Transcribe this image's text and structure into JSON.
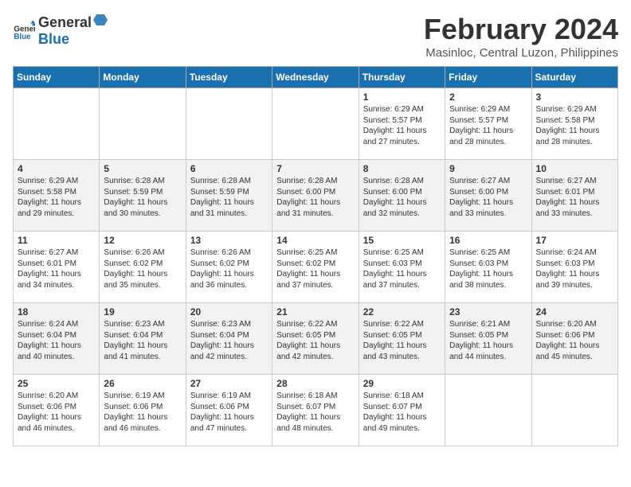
{
  "header": {
    "logo_general": "General",
    "logo_blue": "Blue",
    "title": "February 2024",
    "subtitle": "Masinloc, Central Luzon, Philippines"
  },
  "days_of_week": [
    "Sunday",
    "Monday",
    "Tuesday",
    "Wednesday",
    "Thursday",
    "Friday",
    "Saturday"
  ],
  "weeks": [
    [
      {
        "day": "",
        "content": ""
      },
      {
        "day": "",
        "content": ""
      },
      {
        "day": "",
        "content": ""
      },
      {
        "day": "",
        "content": ""
      },
      {
        "day": "1",
        "content": "Sunrise: 6:29 AM\nSunset: 5:57 PM\nDaylight: 11 hours and 27 minutes."
      },
      {
        "day": "2",
        "content": "Sunrise: 6:29 AM\nSunset: 5:57 PM\nDaylight: 11 hours and 28 minutes."
      },
      {
        "day": "3",
        "content": "Sunrise: 6:29 AM\nSunset: 5:58 PM\nDaylight: 11 hours and 28 minutes."
      }
    ],
    [
      {
        "day": "4",
        "content": "Sunrise: 6:29 AM\nSunset: 5:58 PM\nDaylight: 11 hours and 29 minutes."
      },
      {
        "day": "5",
        "content": "Sunrise: 6:28 AM\nSunset: 5:59 PM\nDaylight: 11 hours and 30 minutes."
      },
      {
        "day": "6",
        "content": "Sunrise: 6:28 AM\nSunset: 5:59 PM\nDaylight: 11 hours and 31 minutes."
      },
      {
        "day": "7",
        "content": "Sunrise: 6:28 AM\nSunset: 6:00 PM\nDaylight: 11 hours and 31 minutes."
      },
      {
        "day": "8",
        "content": "Sunrise: 6:28 AM\nSunset: 6:00 PM\nDaylight: 11 hours and 32 minutes."
      },
      {
        "day": "9",
        "content": "Sunrise: 6:27 AM\nSunset: 6:00 PM\nDaylight: 11 hours and 33 minutes."
      },
      {
        "day": "10",
        "content": "Sunrise: 6:27 AM\nSunset: 6:01 PM\nDaylight: 11 hours and 33 minutes."
      }
    ],
    [
      {
        "day": "11",
        "content": "Sunrise: 6:27 AM\nSunset: 6:01 PM\nDaylight: 11 hours and 34 minutes."
      },
      {
        "day": "12",
        "content": "Sunrise: 6:26 AM\nSunset: 6:02 PM\nDaylight: 11 hours and 35 minutes."
      },
      {
        "day": "13",
        "content": "Sunrise: 6:26 AM\nSunset: 6:02 PM\nDaylight: 11 hours and 36 minutes."
      },
      {
        "day": "14",
        "content": "Sunrise: 6:25 AM\nSunset: 6:02 PM\nDaylight: 11 hours and 37 minutes."
      },
      {
        "day": "15",
        "content": "Sunrise: 6:25 AM\nSunset: 6:03 PM\nDaylight: 11 hours and 37 minutes."
      },
      {
        "day": "16",
        "content": "Sunrise: 6:25 AM\nSunset: 6:03 PM\nDaylight: 11 hours and 38 minutes."
      },
      {
        "day": "17",
        "content": "Sunrise: 6:24 AM\nSunset: 6:03 PM\nDaylight: 11 hours and 39 minutes."
      }
    ],
    [
      {
        "day": "18",
        "content": "Sunrise: 6:24 AM\nSunset: 6:04 PM\nDaylight: 11 hours and 40 minutes."
      },
      {
        "day": "19",
        "content": "Sunrise: 6:23 AM\nSunset: 6:04 PM\nDaylight: 11 hours and 41 minutes."
      },
      {
        "day": "20",
        "content": "Sunrise: 6:23 AM\nSunset: 6:04 PM\nDaylight: 11 hours and 42 minutes."
      },
      {
        "day": "21",
        "content": "Sunrise: 6:22 AM\nSunset: 6:05 PM\nDaylight: 11 hours and 42 minutes."
      },
      {
        "day": "22",
        "content": "Sunrise: 6:22 AM\nSunset: 6:05 PM\nDaylight: 11 hours and 43 minutes."
      },
      {
        "day": "23",
        "content": "Sunrise: 6:21 AM\nSunset: 6:05 PM\nDaylight: 11 hours and 44 minutes."
      },
      {
        "day": "24",
        "content": "Sunrise: 6:20 AM\nSunset: 6:06 PM\nDaylight: 11 hours and 45 minutes."
      }
    ],
    [
      {
        "day": "25",
        "content": "Sunrise: 6:20 AM\nSunset: 6:06 PM\nDaylight: 11 hours and 46 minutes."
      },
      {
        "day": "26",
        "content": "Sunrise: 6:19 AM\nSunset: 6:06 PM\nDaylight: 11 hours and 46 minutes."
      },
      {
        "day": "27",
        "content": "Sunrise: 6:19 AM\nSunset: 6:06 PM\nDaylight: 11 hours and 47 minutes."
      },
      {
        "day": "28",
        "content": "Sunrise: 6:18 AM\nSunset: 6:07 PM\nDaylight: 11 hours and 48 minutes."
      },
      {
        "day": "29",
        "content": "Sunrise: 6:18 AM\nSunset: 6:07 PM\nDaylight: 11 hours and 49 minutes."
      },
      {
        "day": "",
        "content": ""
      },
      {
        "day": "",
        "content": ""
      }
    ]
  ]
}
